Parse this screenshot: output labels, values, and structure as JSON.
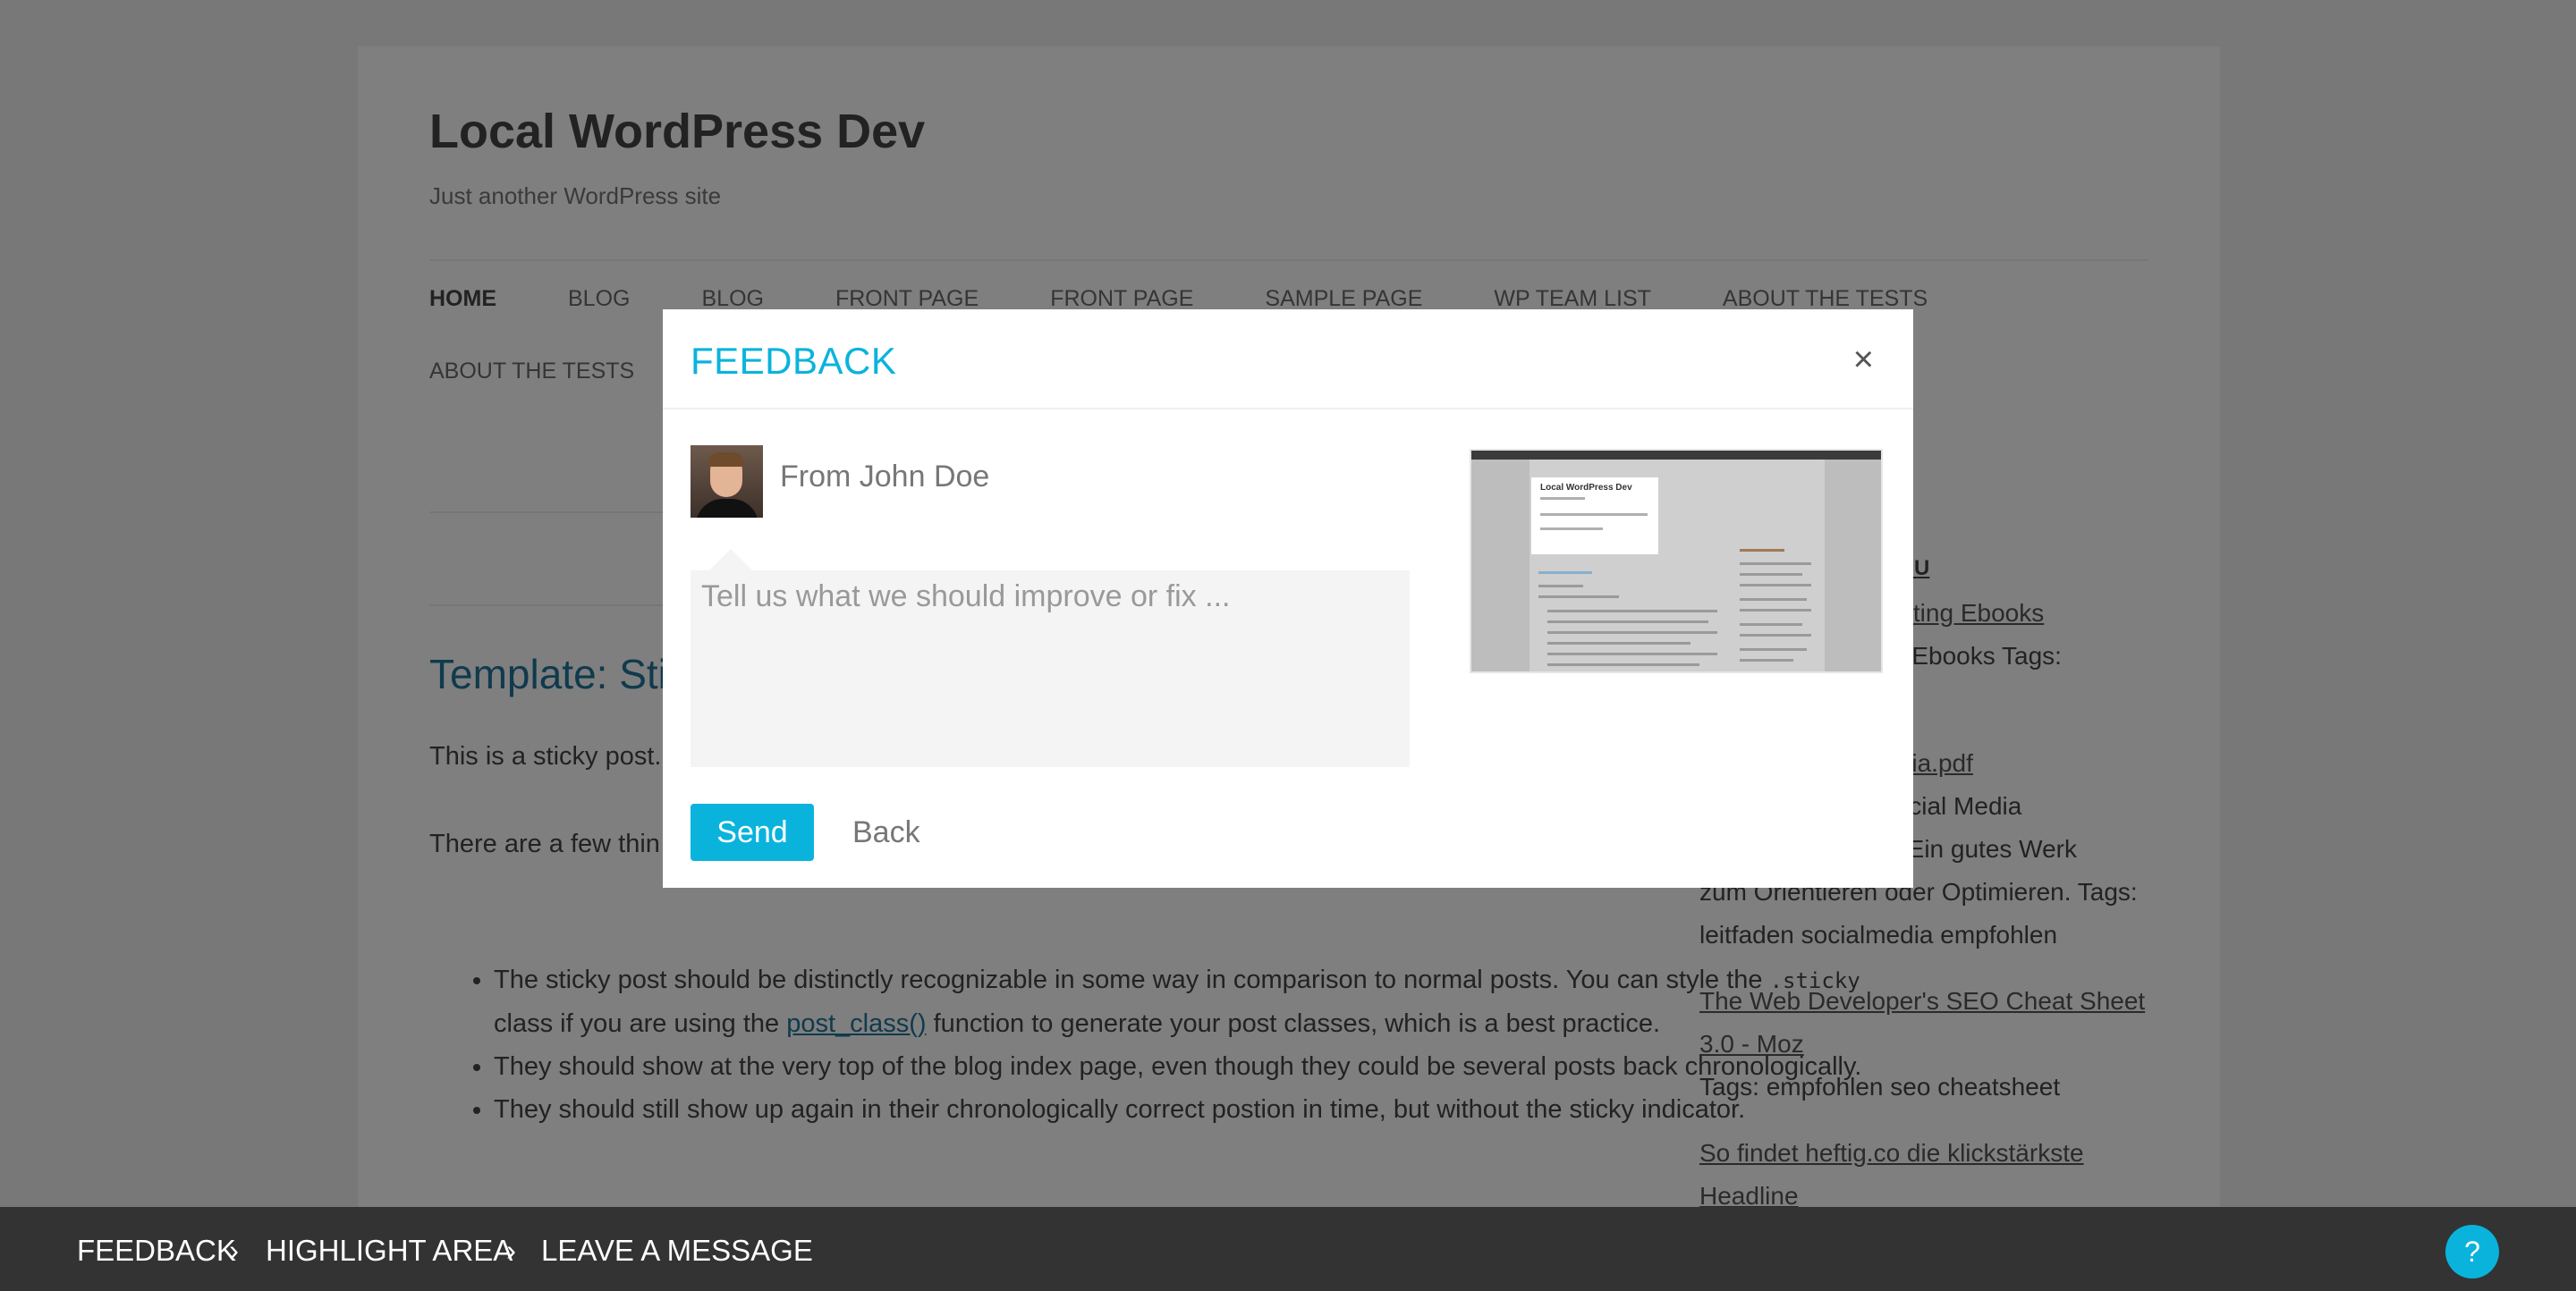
{
  "site": {
    "title": "Local WordPress Dev",
    "description": "Just another WordPress site",
    "nav": [
      "HOME",
      "BLOG",
      "BLOG",
      "FRONT PAGE",
      "FRONT PAGE",
      "SAMPLE PAGE",
      "WP TEAM LIST",
      "ABOUT THE TESTS",
      "ABOUT THE TESTS"
    ],
    "post": {
      "title": "Template: Sti",
      "p1": "This is a sticky post.",
      "p2": "There are a few thin",
      "li1_a": "The sticky post should be distinctly recognizable in some way in comparison to normal posts. You can style the ",
      "li1_code": ".sticky",
      "li1_b": " class if you are using the ",
      "li1_link": "post_class()",
      "li1_c": " function to generate your post classes, which is a best practice.",
      "li2": "They should show at the very top of the blog index page, even though they could be several posts back chronologically.",
      "li3": "They should still show up again in their chronologically correct postion in time, but without the sticky indicator."
    },
    "sidebar": {
      "heading": "N SU",
      "link1": "rketing Ebooks",
      "text1": "se Ebooks Tags:",
      "link2": "ledia.pdf",
      "text2a": "Social Media",
      "text2b": "rt. Ein gutes Werk",
      "text2c": "zum Orientieren oder Optimieren. Tags:",
      "text2d": "leitfaden socialmedia empfohlen",
      "link3a": "The Web Developer's SEO Cheat Sheet",
      "link3b": "3.0 - Moz",
      "text3": "Tags: empfohlen seo cheatsheet",
      "link4a": "So findet heftig.co die klickstärkste",
      "link4b": "Headline"
    }
  },
  "modal": {
    "title": "FEEDBACK",
    "close_label": "×",
    "from_label": "From John Doe",
    "message_placeholder": "Tell us what we should improve or fix ...",
    "message_value": "",
    "send_label": "Send",
    "back_label": "Back",
    "thumbnail": {
      "title": "Local WordPress Dev"
    }
  },
  "bottombar": {
    "steps": [
      "FEEDBACK",
      "HIGHLIGHT AREA",
      "LEAVE A MESSAGE"
    ],
    "separator": "›",
    "help_label": "?"
  },
  "colors": {
    "accent": "#0ab3dc",
    "bottombar": "#333333",
    "link": "#21759b"
  }
}
